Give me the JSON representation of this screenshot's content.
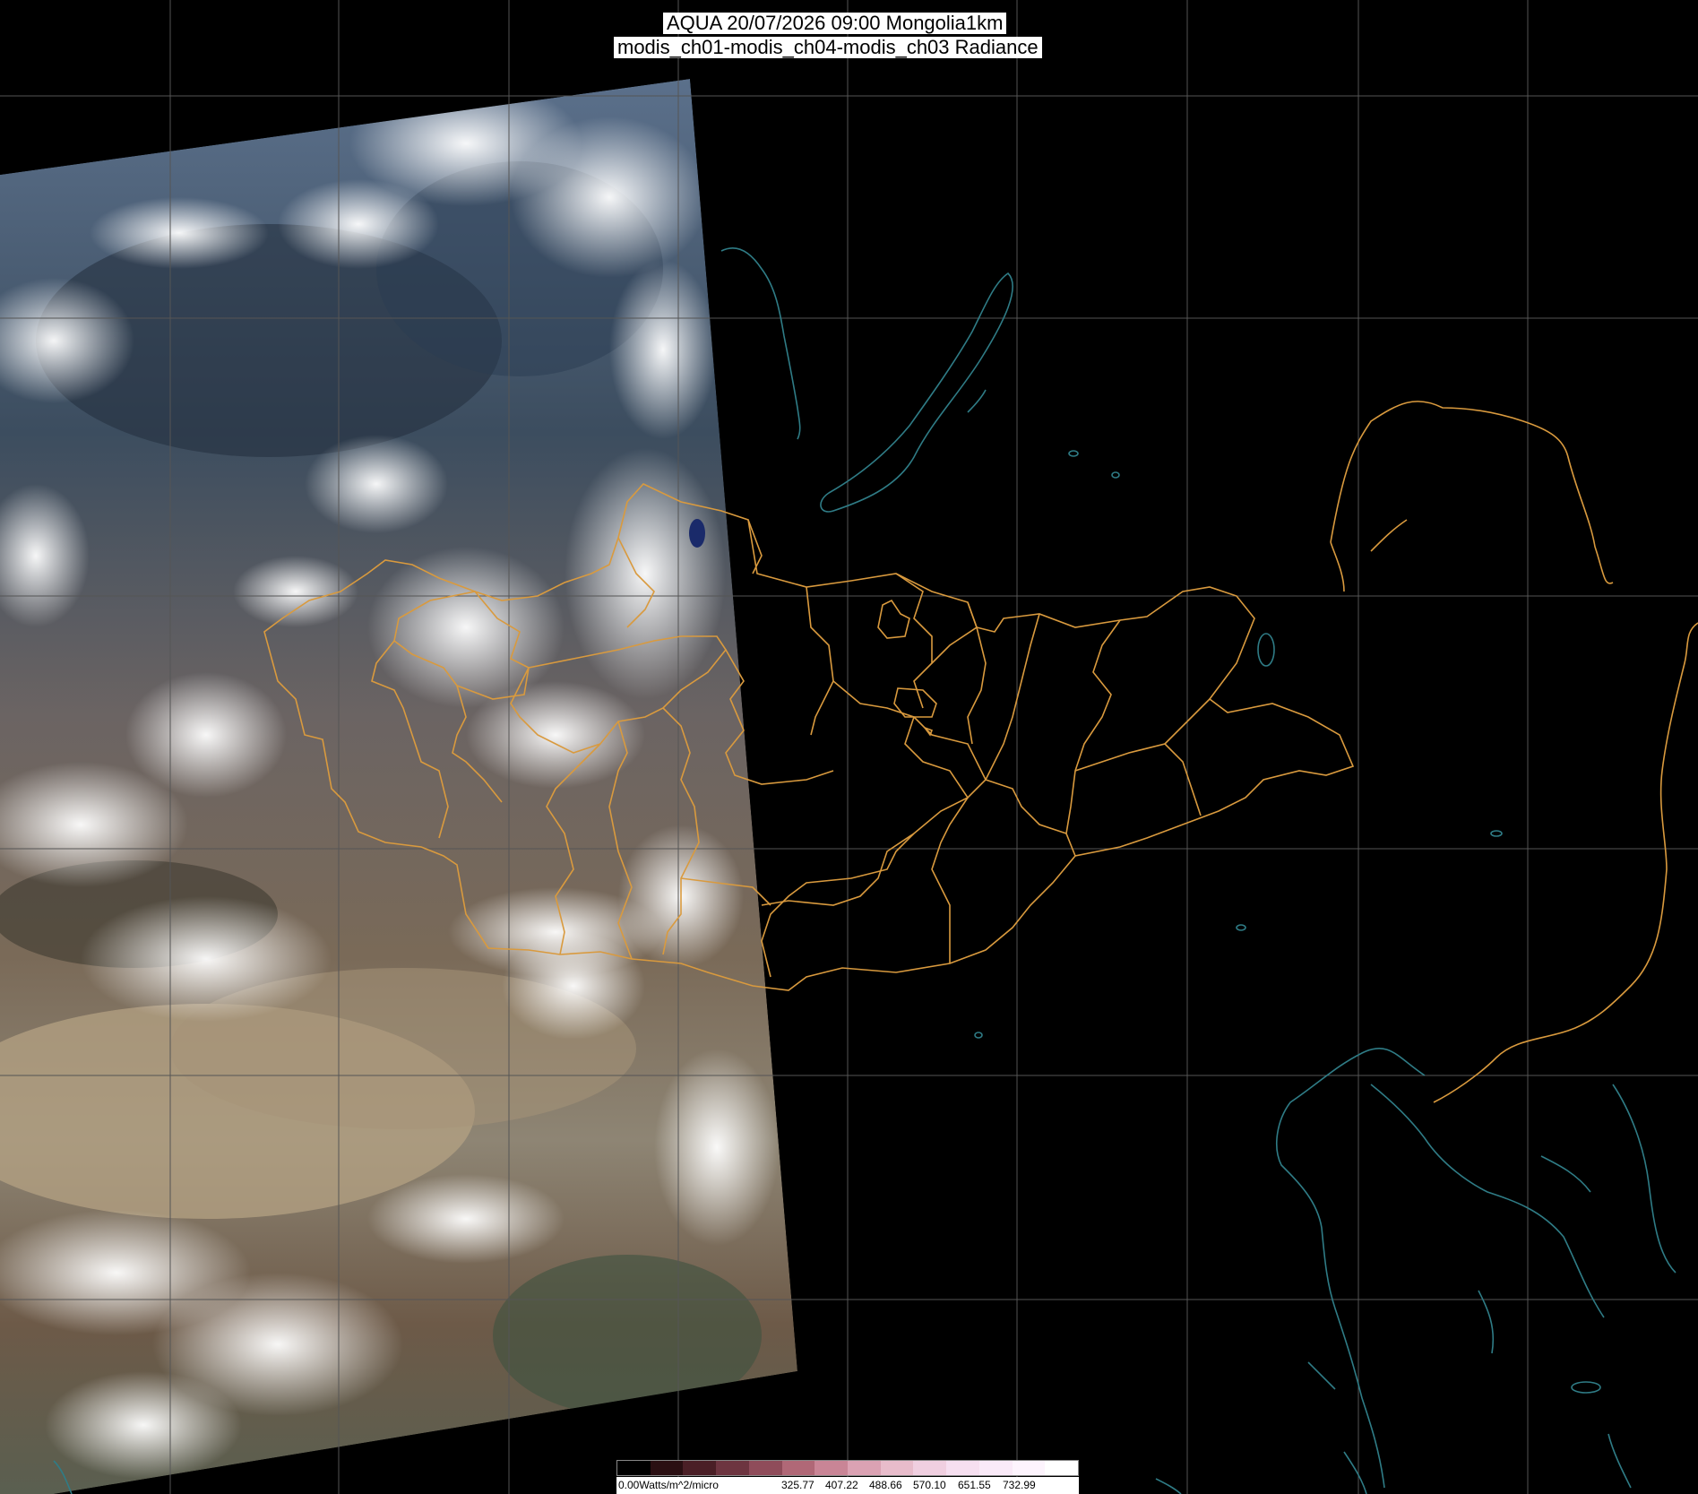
{
  "title": {
    "line1": "AQUA 20/07/2026 09:00 Mongolia1km",
    "line2": "modis_ch01-modis_ch04-modis_ch03 Radiance"
  },
  "colorbar": {
    "labels": [
      "0.00Watts/m^2/micro",
      "325.77",
      "407.22",
      "488.66",
      "570.10",
      "651.55",
      "732.99"
    ],
    "colors": [
      "#000000",
      "#2a0f12",
      "#4a1f26",
      "#6d3540",
      "#8f4c5a",
      "#b06877",
      "#c98596",
      "#dba2b3",
      "#e8bccb",
      "#f0cfe0",
      "#f6dff0",
      "#faeaf8",
      "#fdf4fd",
      "#ffffff"
    ]
  },
  "colors": {
    "background": "#000000",
    "graticule": "#555555",
    "boundary": "#d99a3e",
    "coastline": "#2f7c86"
  },
  "layers": [
    "satellite-swath",
    "graticule",
    "coastline",
    "admin-boundaries"
  ]
}
